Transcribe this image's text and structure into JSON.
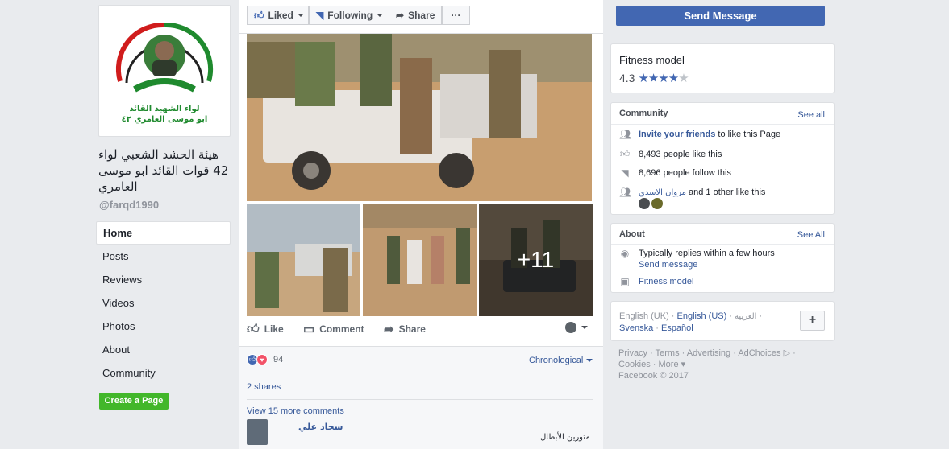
{
  "page": {
    "name": "هيئة الحشد الشعبي لواء 42 قوات القائد ابو موسى العامري",
    "handle": "@farqd1990",
    "logo_text_line1": "لواء الشهيد القائد",
    "logo_text_line2": "ابو موسى العامري ٤٢"
  },
  "nav": {
    "items": [
      "Home",
      "Posts",
      "Reviews",
      "Videos",
      "Photos",
      "About",
      "Community"
    ],
    "create_page": "Create a Page"
  },
  "actions": {
    "liked": "Liked",
    "following": "Following",
    "share": "Share",
    "more": "···"
  },
  "post": {
    "more_photos": "+11",
    "like": "Like",
    "comment": "Comment",
    "share": "Share",
    "reaction_count": "94",
    "sort": "Chronological",
    "shares": "2 shares",
    "view_more": "View 15 more comments",
    "commenter": "سجاد علي",
    "comment_text": "متورين الأبطال"
  },
  "sidebar": {
    "send_message": "Send Message",
    "category": "Fitness model",
    "rating": "4.3",
    "community": {
      "title": "Community",
      "see_all": "See all",
      "invite_link": "Invite your friends",
      "invite_rest": " to like this Page",
      "likes": "8,493 people like this",
      "follows": "8,696 people follow this",
      "friend_name": "مروان الاسدي",
      "friend_rest": " and 1 other like this"
    },
    "about": {
      "title": "About",
      "see_all": "See All",
      "replies": "Typically replies within a few hours",
      "send_message": "Send message",
      "category": "Fitness model"
    },
    "languages": {
      "english_uk": "English (UK)",
      "english_us": "English (US)",
      "arabic": "العربية",
      "svenska": "Svenska",
      "espanol": "Español",
      "plus": "+"
    },
    "footer": {
      "line1": "Privacy · Terms · Advertising · AdChoices ▷ ·",
      "line2": "Cookies · More ▾",
      "line3": "Facebook © 2017"
    }
  },
  "colors": {
    "fb_blue": "#4267b2",
    "link": "#365899",
    "green": "#42b72a",
    "background": "#e9ebee"
  }
}
